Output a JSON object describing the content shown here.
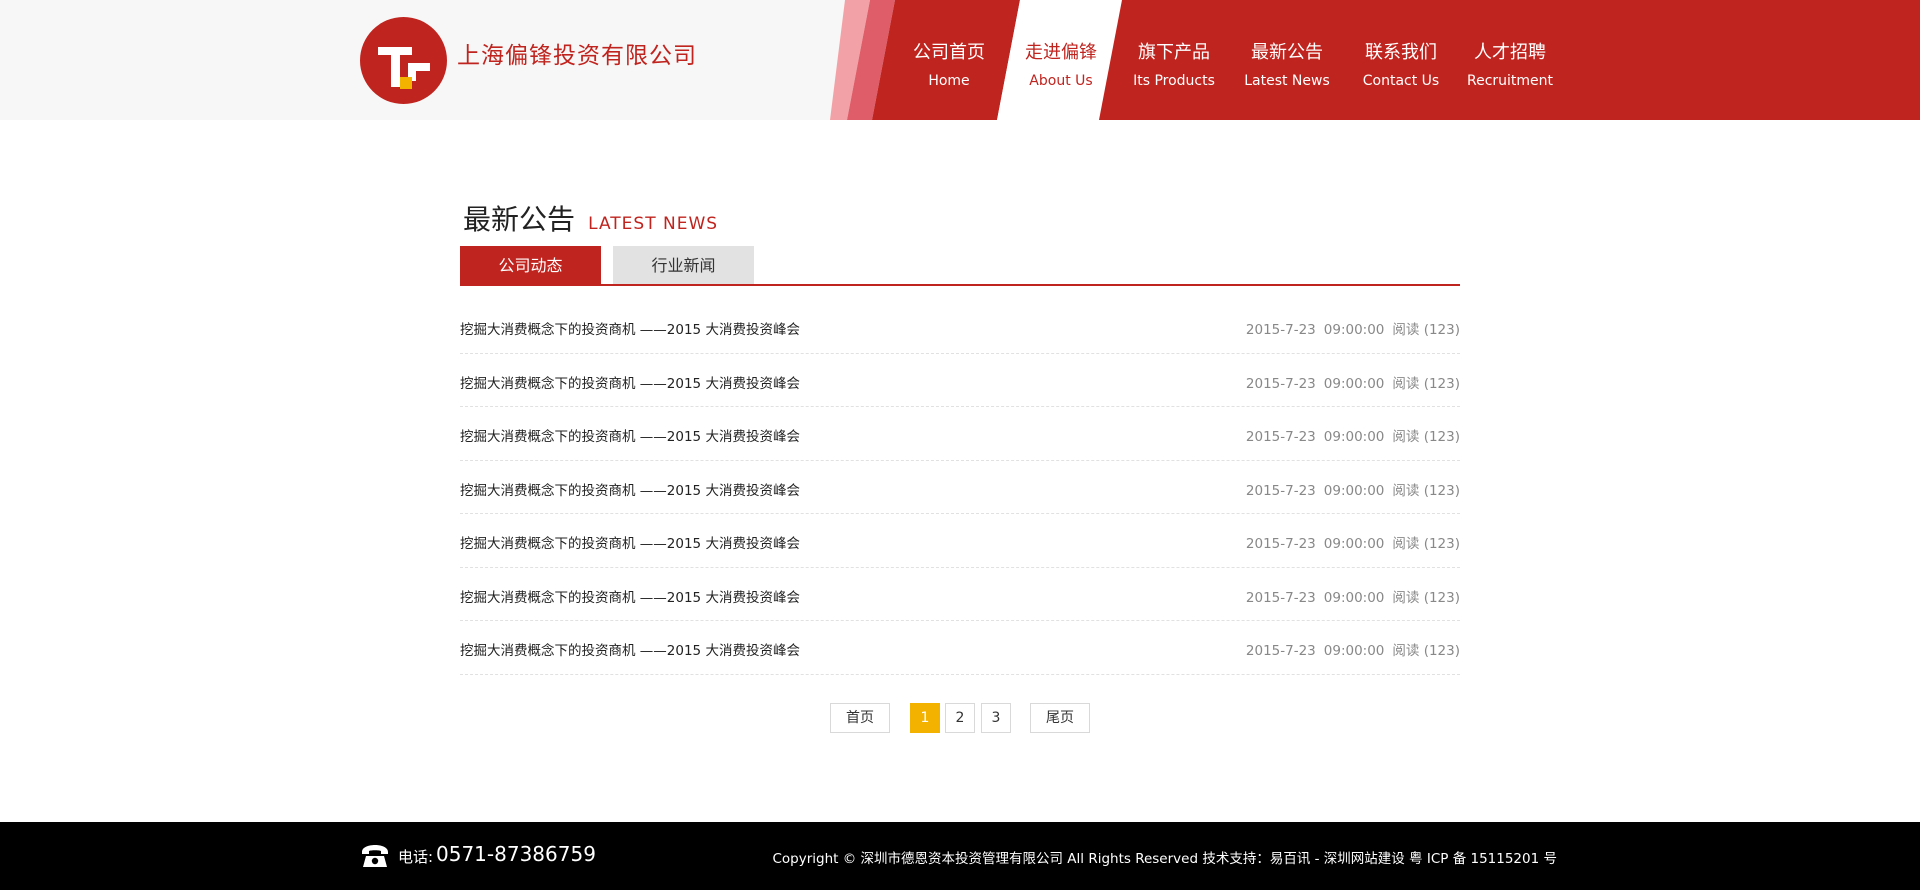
{
  "brand": {
    "company_name": "上海偏锋投资有限公司",
    "primary_color": "#c0241f",
    "accent_color": "#f3b200"
  },
  "nav": {
    "items": [
      {
        "cn": "公司首页",
        "en": "Home",
        "active": false
      },
      {
        "cn": "走进偏锋",
        "en": "About Us",
        "active": true
      },
      {
        "cn": "旗下产品",
        "en": "Its Products",
        "active": false
      },
      {
        "cn": "最新公告",
        "en": "Latest  News",
        "active": false
      },
      {
        "cn": "联系我们",
        "en": "Contact Us",
        "active": false
      },
      {
        "cn": "人才招聘",
        "en": "Recruitment",
        "active": false
      }
    ]
  },
  "section": {
    "title_cn": "最新公告",
    "title_en": "LATEST  NEWS"
  },
  "tabs": [
    {
      "label": "公司动态",
      "active": true
    },
    {
      "label": "行业新闻",
      "active": false
    }
  ],
  "news": [
    {
      "title": "挖掘大消费概念下的投资商机 ——2015 大消费投资峰会",
      "date": "2015-7-23",
      "time": "09:00:00",
      "views": "阅读 (123)"
    },
    {
      "title": "挖掘大消费概念下的投资商机 ——2015 大消费投资峰会",
      "date": "2015-7-23",
      "time": "09:00:00",
      "views": "阅读 (123)"
    },
    {
      "title": "挖掘大消费概念下的投资商机 ——2015 大消费投资峰会",
      "date": "2015-7-23",
      "time": "09:00:00",
      "views": "阅读 (123)"
    },
    {
      "title": "挖掘大消费概念下的投资商机 ——2015 大消费投资峰会",
      "date": "2015-7-23",
      "time": "09:00:00",
      "views": "阅读 (123)"
    },
    {
      "title": "挖掘大消费概念下的投资商机 ——2015 大消费投资峰会",
      "date": "2015-7-23",
      "time": "09:00:00",
      "views": "阅读 (123)"
    },
    {
      "title": "挖掘大消费概念下的投资商机 ——2015 大消费投资峰会",
      "date": "2015-7-23",
      "time": "09:00:00",
      "views": "阅读 (123)"
    },
    {
      "title": "挖掘大消费概念下的投资商机 ——2015 大消费投资峰会",
      "date": "2015-7-23",
      "time": "09:00:00",
      "views": "阅读 (123)"
    }
  ],
  "pagination": {
    "first": "首页",
    "pages": [
      "1",
      "2",
      "3"
    ],
    "current": "1",
    "last": "尾页"
  },
  "footer": {
    "phone_icon": "telephone-icon",
    "phone_label": "电话:",
    "phone_number": "0571-87386759",
    "copyright": "Copyright © 深圳市德恩资本投资管理有限公司  All Rights Reserved  技术支持：易百讯 - 深圳网站建设 粤 ICP 备 15115201 号"
  }
}
